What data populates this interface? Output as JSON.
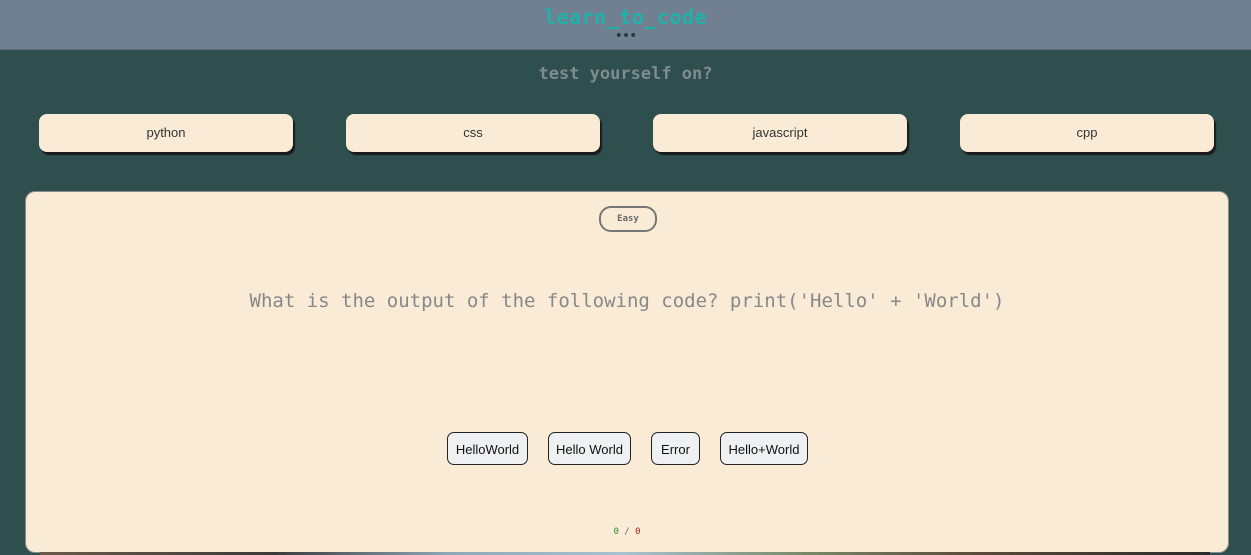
{
  "header": {
    "title": "learn_to_code",
    "menu_icon": "more-dots"
  },
  "prompt": "test yourself on?",
  "languages": [
    "python",
    "css",
    "javascript",
    "cpp"
  ],
  "quiz": {
    "difficulty": "Easy",
    "question": "What is the output of the following code? print('Hello' + 'World')",
    "answers": [
      "HelloWorld",
      "Hello World",
      "Error",
      "Hello+World"
    ],
    "score": {
      "correct": "0",
      "separator": "/",
      "wrong": "0"
    }
  },
  "colors": {
    "background": "#2f4f4f",
    "header": "#708090",
    "title": "#20b2aa",
    "card": "#faebd7",
    "correct": "#2e8b2e",
    "wrong": "#b22222"
  }
}
